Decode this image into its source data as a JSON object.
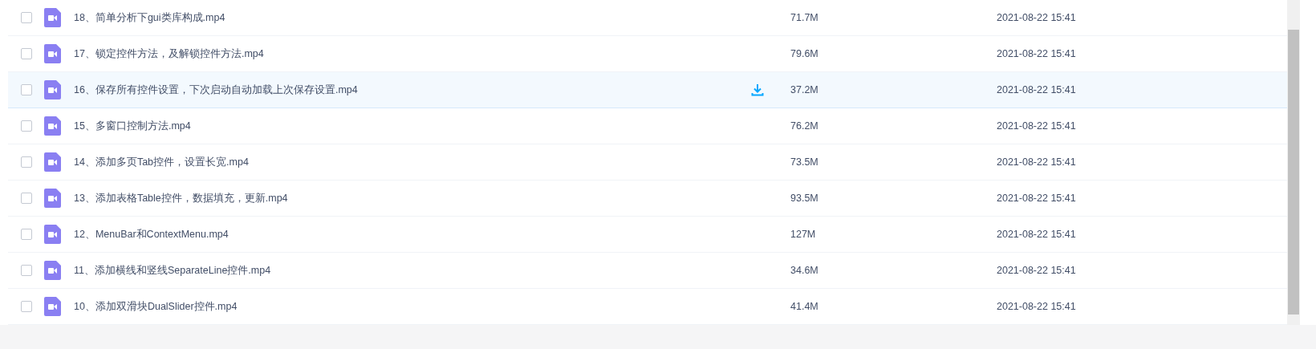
{
  "files": [
    {
      "name": "18、简单分析下gui类库构成.mp4",
      "size": "71.7M",
      "date": "2021-08-22 15:41",
      "checked": false,
      "hovered": false
    },
    {
      "name": "17、锁定控件方法，及解锁控件方法.mp4",
      "size": "79.6M",
      "date": "2021-08-22 15:41",
      "checked": false,
      "hovered": false
    },
    {
      "name": "16、保存所有控件设置，下次启动自动加载上次保存设置.mp4",
      "size": "37.2M",
      "date": "2021-08-22 15:41",
      "checked": false,
      "hovered": true
    },
    {
      "name": "15、多窗口控制方法.mp4",
      "size": "76.2M",
      "date": "2021-08-22 15:41",
      "checked": false,
      "hovered": false
    },
    {
      "name": "14、添加多页Tab控件，设置长宽.mp4",
      "size": "73.5M",
      "date": "2021-08-22 15:41",
      "checked": false,
      "hovered": false
    },
    {
      "name": "13、添加表格Table控件，数据填充，更新.mp4",
      "size": "93.5M",
      "date": "2021-08-22 15:41",
      "checked": false,
      "hovered": false
    },
    {
      "name": "12、MenuBar和ContextMenu.mp4",
      "size": "127M",
      "date": "2021-08-22 15:41",
      "checked": false,
      "hovered": false
    },
    {
      "name": "11、添加横线和竖线SeparateLine控件.mp4",
      "size": "34.6M",
      "date": "2021-08-22 15:41",
      "checked": false,
      "hovered": false
    },
    {
      "name": "10、添加双滑块DualSlider控件.mp4",
      "size": "41.4M",
      "date": "2021-08-22 15:41",
      "checked": false,
      "hovered": false
    }
  ]
}
